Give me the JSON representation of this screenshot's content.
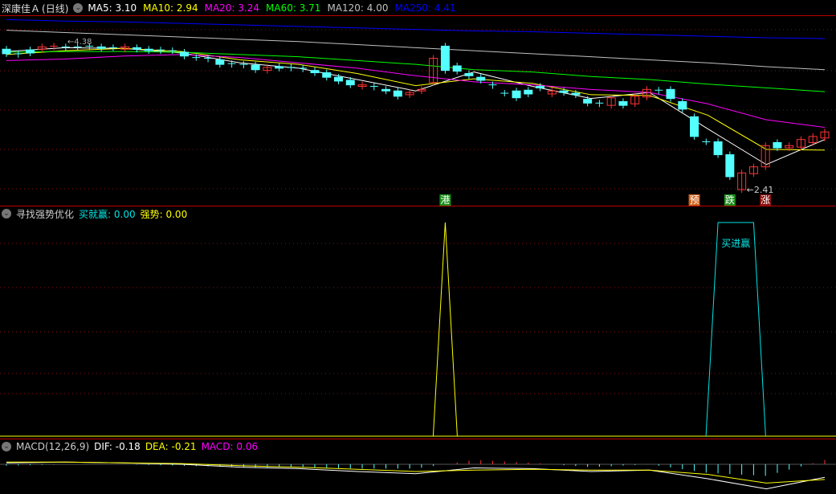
{
  "main": {
    "stock_name": "深康佳Ａ",
    "period": "(日线)",
    "ma": [
      {
        "label": "MA5",
        "value": "3.10",
        "color": "#ffffff"
      },
      {
        "label": "MA10",
        "value": "2.94",
        "color": "#ffff00"
      },
      {
        "label": "MA20",
        "value": "3.24",
        "color": "#ff00ff"
      },
      {
        "label": "MA60",
        "value": "3.71",
        "color": "#00ff00"
      },
      {
        "label": "MA120",
        "value": "4.00",
        "color": "#c0c0c0"
      },
      {
        "label": "MA250",
        "value": "4.41",
        "color": "#0000ff"
      }
    ],
    "low_marker": "←2.41",
    "high_marker": "←4.38",
    "signals": [
      {
        "text": "港",
        "candle": 37,
        "bg": "#1a8f1a"
      },
      {
        "text": "预",
        "candle": 58,
        "bg": "#d0601a"
      },
      {
        "text": "跌",
        "candle": 61,
        "bg": "#1a8f1a"
      },
      {
        "text": "涨",
        "candle": 64,
        "bg": "#8a1010"
      }
    ],
    "candles": [
      [
        4.27,
        4.21
      ],
      [
        4.21,
        4.2
      ],
      [
        4.26,
        4.22
      ],
      [
        4.27,
        4.3
      ],
      [
        4.3,
        4.31
      ],
      [
        4.3,
        4.29
      ],
      [
        4.3,
        4.3
      ],
      [
        4.31,
        4.3
      ],
      [
        4.3,
        4.28
      ],
      [
        4.29,
        4.29
      ],
      [
        4.27,
        4.3
      ],
      [
        4.29,
        4.27
      ],
      [
        4.27,
        4.25
      ],
      [
        4.26,
        4.25
      ],
      [
        4.25,
        4.25
      ],
      [
        4.23,
        4.18
      ],
      [
        4.16,
        4.16
      ],
      [
        4.15,
        4.14
      ],
      [
        4.13,
        4.07
      ],
      [
        4.08,
        4.07
      ],
      [
        4.07,
        4.06
      ],
      [
        4.06,
        4.0
      ],
      [
        3.99,
        4.03
      ],
      [
        4.04,
        4.02
      ],
      [
        4.03,
        4.02
      ],
      [
        4.02,
        4.01
      ],
      [
        3.99,
        3.96
      ],
      [
        3.96,
        3.9
      ],
      [
        3.9,
        3.85
      ],
      [
        3.86,
        3.8
      ],
      [
        3.78,
        3.8
      ],
      [
        3.78,
        3.77
      ],
      [
        3.74,
        3.72
      ],
      [
        3.72,
        3.65
      ],
      [
        3.67,
        3.7
      ],
      [
        3.72,
        3.74
      ],
      [
        3.83,
        4.15
      ],
      [
        4.31,
        3.99
      ],
      [
        4.05,
        3.98
      ],
      [
        3.95,
        3.92
      ],
      [
        3.9,
        3.86
      ],
      [
        3.8,
        3.79
      ],
      [
        3.69,
        3.69
      ],
      [
        3.72,
        3.63
      ],
      [
        3.73,
        3.68
      ],
      [
        3.78,
        3.76
      ],
      [
        3.68,
        3.72
      ],
      [
        3.72,
        3.7
      ],
      [
        3.69,
        3.67
      ],
      [
        3.61,
        3.56
      ],
      [
        3.56,
        3.55
      ],
      [
        3.53,
        3.63
      ],
      [
        3.58,
        3.53
      ],
      [
        3.55,
        3.65
      ],
      [
        3.64,
        3.74
      ],
      [
        3.73,
        3.72
      ],
      [
        3.74,
        3.62
      ],
      [
        3.58,
        3.48
      ],
      [
        3.38,
        3.12
      ],
      [
        3.05,
        3.05
      ],
      [
        3.05,
        2.88
      ],
      [
        2.88,
        2.59
      ],
      [
        2.42,
        2.64
      ],
      [
        2.63,
        2.72
      ],
      [
        2.72,
        3.0
      ],
      [
        3.04,
        2.97
      ],
      [
        2.97,
        3.0
      ],
      [
        2.98,
        3.08
      ],
      [
        3.04,
        3.12
      ],
      [
        3.1,
        3.18
      ]
    ],
    "ma_lines": {
      "MA5": [
        4.24,
        4.29,
        4.28,
        4.22,
        4.09,
        4.02,
        3.87,
        3.72,
        3.97,
        3.78,
        3.62,
        3.7,
        3.22,
        2.75,
        3.08
      ],
      "MA10": [
        4.2,
        4.25,
        4.28,
        4.24,
        4.13,
        4.07,
        3.95,
        3.79,
        3.88,
        3.82,
        3.67,
        3.66,
        3.4,
        2.95,
        2.94
      ],
      "MA20": [
        4.12,
        4.14,
        4.18,
        4.2,
        4.16,
        4.09,
        4.02,
        3.92,
        3.84,
        3.8,
        3.74,
        3.7,
        3.55,
        3.34,
        3.24
      ],
      "MA60": [
        4.23,
        4.24,
        4.24,
        4.23,
        4.2,
        4.17,
        4.12,
        4.07,
        4.0,
        3.97,
        3.91,
        3.87,
        3.81,
        3.76,
        3.71
      ],
      "MA120": [
        4.52,
        4.49,
        4.46,
        4.43,
        4.4,
        4.37,
        4.33,
        4.29,
        4.25,
        4.21,
        4.17,
        4.13,
        4.09,
        4.04,
        4.0
      ],
      "MA250": [
        4.66,
        4.64,
        4.63,
        4.61,
        4.59,
        4.57,
        4.55,
        4.53,
        4.51,
        4.5,
        4.48,
        4.46,
        4.44,
        4.42,
        4.41
      ]
    },
    "up_color": "#ff3333",
    "down_color": "#54ffff"
  },
  "indicator": {
    "name": "寻找强势优化",
    "lines": [
      {
        "label": "买就赢",
        "value": "0.00",
        "color": "#00e5e5"
      },
      {
        "label": "强势",
        "value": "0.00",
        "color": "#ffff00"
      }
    ],
    "annotation": "买进赢",
    "strong_spikes": [
      37
    ],
    "buy_plateau": [
      60,
      61,
      62,
      63
    ]
  },
  "macd": {
    "name": "MACD(12,26,9)",
    "dif": {
      "label": "DIF",
      "value": "-0.18",
      "color": "#ffffff"
    },
    "dea": {
      "label": "DEA",
      "value": "-0.21",
      "color": "#ffff00"
    },
    "macd": {
      "label": "MACD",
      "value": "0.06",
      "color": "#ff00ff"
    },
    "dif_line": [
      0.02,
      0.03,
      0.02,
      0.0,
      -0.04,
      -0.06,
      -0.1,
      -0.13,
      -0.05,
      -0.06,
      -0.1,
      -0.08,
      -0.2,
      -0.34,
      -0.18
    ],
    "dea_line": [
      0.03,
      0.03,
      0.02,
      0.01,
      -0.02,
      -0.04,
      -0.07,
      -0.1,
      -0.08,
      -0.07,
      -0.08,
      -0.08,
      -0.14,
      -0.26,
      -0.21
    ]
  }
}
